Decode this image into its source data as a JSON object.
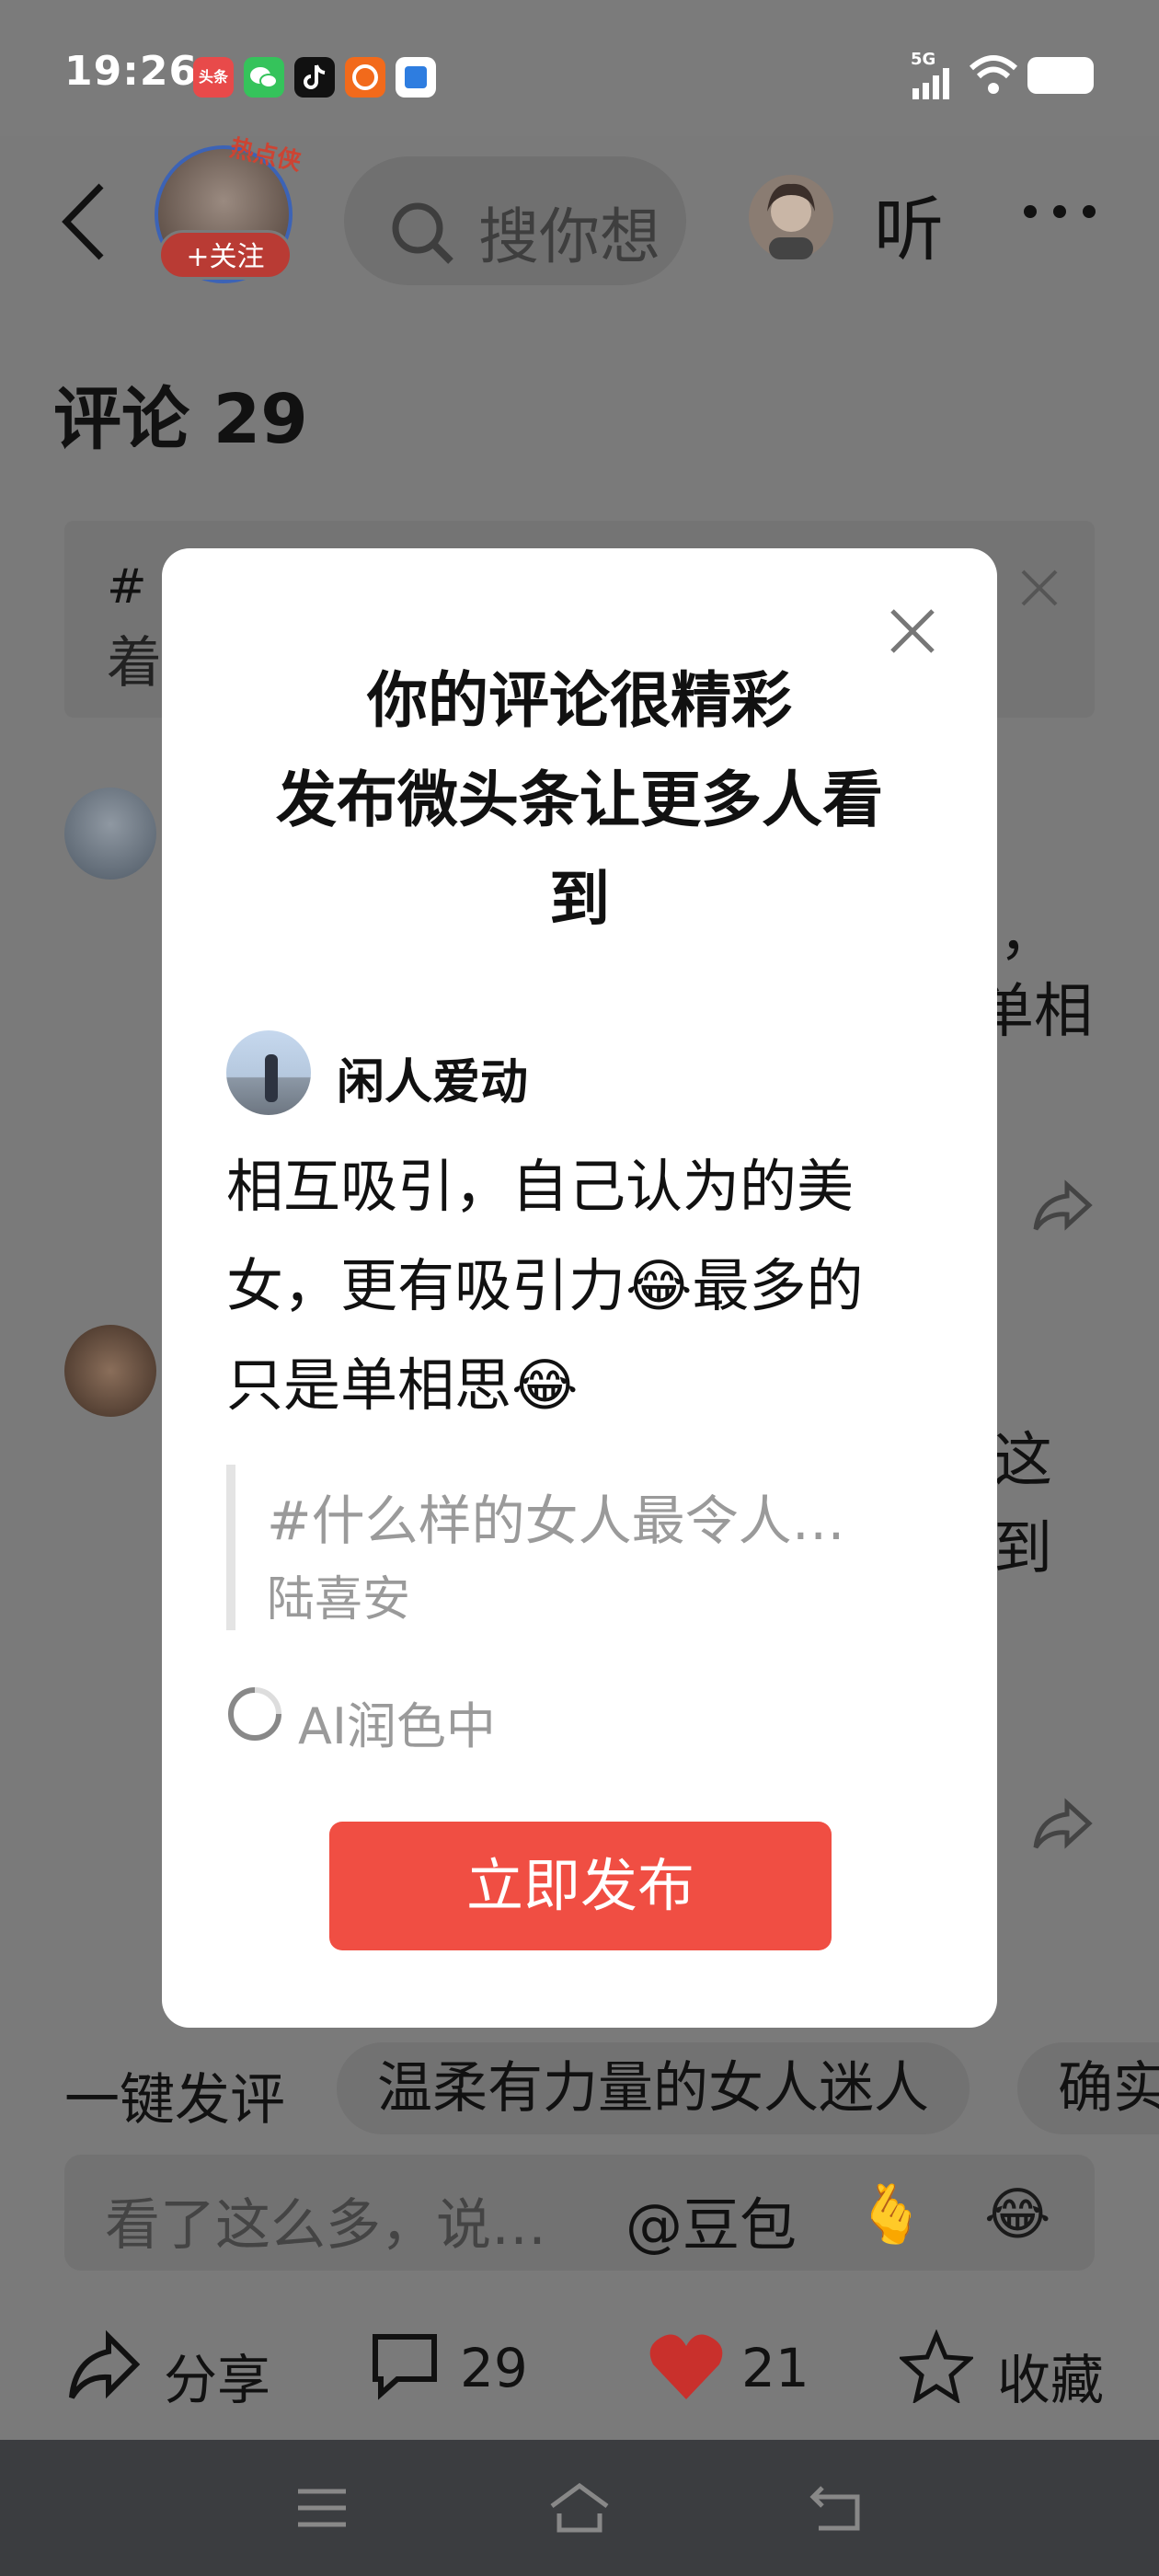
{
  "status_bar": {
    "time": "19:26",
    "toutiao_icon_label": "头条",
    "network": "5G",
    "app_icons": [
      "toutiao-icon",
      "wechat-icon",
      "tiktok-icon",
      "alibaba-1688-icon",
      "cloud-app-icon"
    ]
  },
  "header": {
    "hot_badge": "热点侠",
    "follow_label": "+关注",
    "search_placeholder": "搜你想",
    "listen_label": "听"
  },
  "page": {
    "comments_title": "评论 29",
    "tip_hash": "#",
    "tip_text": "着",
    "comment1_fragment_a": "，",
    "comment1_fragment_b": "单相",
    "comment2_fragment_a": "这",
    "comment2_fragment_b": "到"
  },
  "chips": {
    "one_click": "一键发评",
    "items": [
      "温柔有力量的女人迷人",
      "确实"
    ]
  },
  "input": {
    "placeholder": "看了这么多，说…",
    "mention": "@豆包",
    "emoji_1": "🫰",
    "emoji_2": "😂"
  },
  "action_bar": {
    "share_label": "分享",
    "comment_count": "29",
    "like_count": "21",
    "favorite_label": "收藏"
  },
  "modal": {
    "title_line1": "你的评论很精彩",
    "title_line2": "发布微头条让更多人看",
    "title_line3": "到",
    "author_name": "闲人爱动",
    "comment_line1": "相互吸引，自己认为的美",
    "comment_line2": "女，更有吸引力😂最多的",
    "comment_line3": "只是单相思😂",
    "quote_topic": "#什么样的女人最令人…",
    "quote_author": "陆喜安",
    "ai_status": "AI润色中",
    "publish_label": "立即发布"
  },
  "colors": {
    "publish_button": "#f04e43",
    "overlay_gray": "#7a7a7a",
    "like_heart": "#c9302c",
    "navbar": "#3b3d40"
  }
}
